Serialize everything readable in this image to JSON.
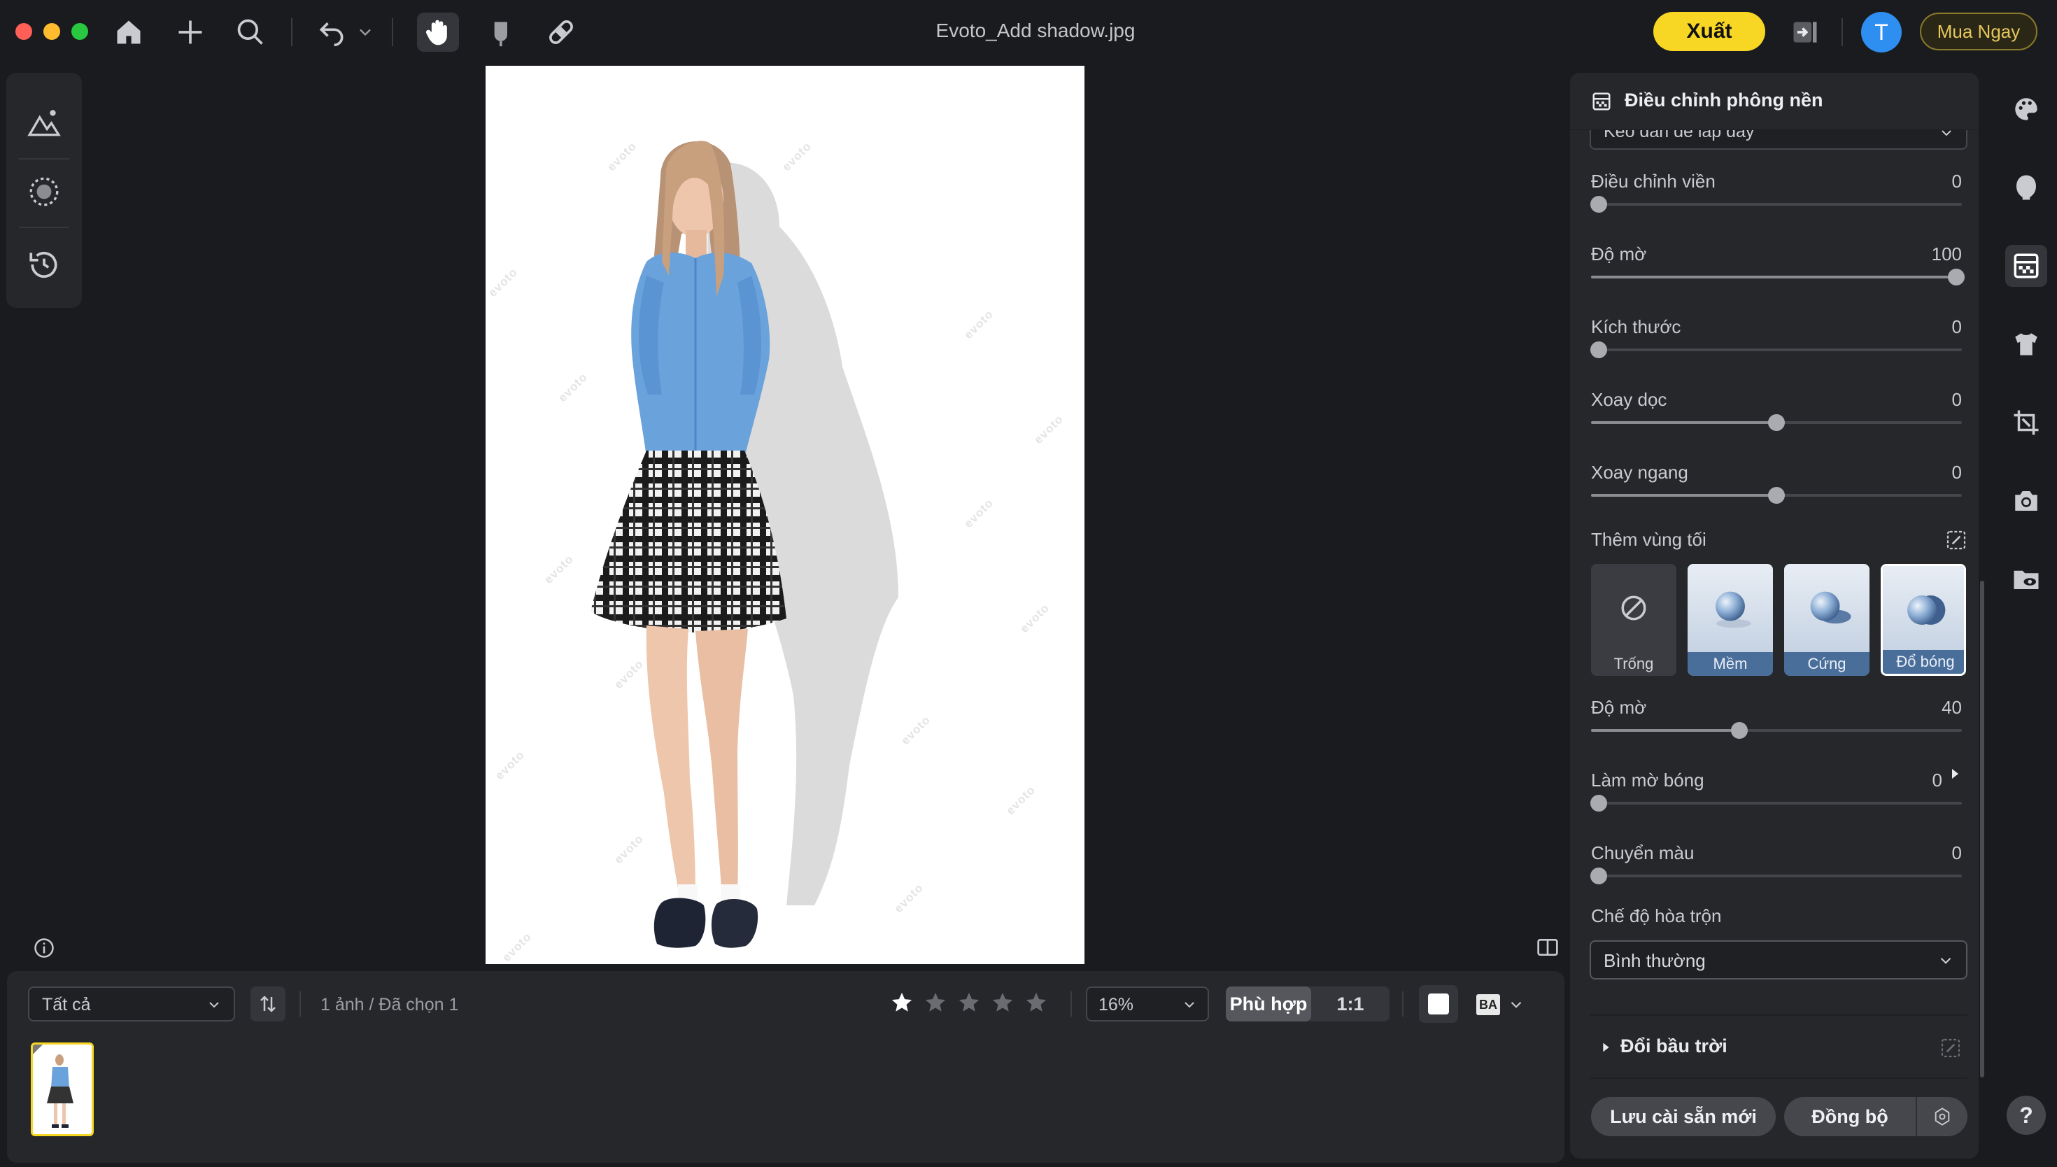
{
  "window": {
    "title": "Evoto_Add shadow.jpg"
  },
  "topbar": {
    "export_label": "Xuất",
    "avatar_initial": "T",
    "buy_label": "Mua Ngay"
  },
  "canvas": {
    "watermark": "evoto"
  },
  "filmstrip": {
    "filter_value": "Tất cả",
    "count_text": "1 ảnh / Đã chọn 1",
    "rating": 1,
    "rating_max": 5,
    "zoom_value": "16%",
    "fit_label": "Phù hợp",
    "one_to_one_label": "1:1",
    "ba_label": "BA"
  },
  "panel": {
    "title": "Điều chỉnh phông nền",
    "partial_select": "Kéo dán để lấp đầy",
    "sliders_top": [
      {
        "label": "Điều chỉnh viền",
        "value": "0",
        "fraction": 0.0
      },
      {
        "label": "Độ mờ",
        "value": "100",
        "fraction": 1.0
      },
      {
        "label": "Kích thước",
        "value": "0",
        "fraction": 0.0
      },
      {
        "label": "Xoay dọc",
        "value": "0",
        "fraction": 0.5
      },
      {
        "label": "Xoay ngang",
        "value": "0",
        "fraction": 0.5
      }
    ],
    "dark_area_label": "Thêm vùng tối",
    "shadow_options": [
      {
        "label": "Trống"
      },
      {
        "label": "Mềm"
      },
      {
        "label": "Cứng"
      },
      {
        "label": "Đổ bóng"
      }
    ],
    "selected_shadow": "Đổ bóng",
    "sliders_bottom": [
      {
        "label": "Độ mờ",
        "value": "40",
        "fraction": 0.4
      },
      {
        "label": "Làm mờ bóng",
        "value": "0",
        "fraction": 0.0
      },
      {
        "label": "Chuyển màu",
        "value": "0",
        "fraction": 0.0
      }
    ],
    "blend_label": "Chế độ hòa trộn",
    "blend_value": "Bình thường",
    "sky_label": "Đổi bầu trời",
    "save_preset_label": "Lưu cài sẵn mới",
    "sync_label": "Đồng bộ"
  },
  "rail": [
    "palette-icon",
    "face-icon",
    "background-icon",
    "clothing-icon",
    "crop-icon",
    "camera-icon",
    "folder-eye-icon"
  ],
  "colors": {
    "accent": "#f7d624",
    "avatar": "#2f8ff0",
    "tile_label": "#4a6e9a"
  }
}
